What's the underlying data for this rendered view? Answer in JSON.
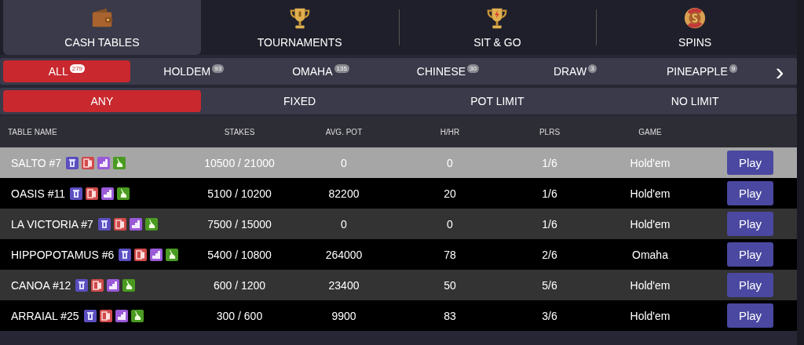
{
  "tabs": [
    {
      "label": "CASH TABLES",
      "kind": "wallet",
      "selected": true
    },
    {
      "label": "TOURNAMENTS",
      "kind": "trophy",
      "selected": false
    },
    {
      "label": "SIT & GO",
      "kind": "bolt-trophy",
      "selected": false
    },
    {
      "label": "SPINS",
      "kind": "chip",
      "selected": false
    }
  ],
  "game_filters": [
    {
      "label": "ALL",
      "count": "279",
      "selected": true
    },
    {
      "label": "HOLDEM",
      "count": "93",
      "selected": false
    },
    {
      "label": "OMAHA",
      "count": "135",
      "selected": false
    },
    {
      "label": "CHINESE",
      "count": "30",
      "selected": false
    },
    {
      "label": "DRAW",
      "count": "3",
      "selected": false
    },
    {
      "label": "PINEAPPLE",
      "count": "9",
      "selected": false
    }
  ],
  "next_button": "›",
  "limit_filters": [
    {
      "label": "ANY",
      "selected": true
    },
    {
      "label": "FIXED",
      "selected": false
    },
    {
      "label": "POT LIMIT",
      "selected": false
    },
    {
      "label": "NO LIMIT",
      "selected": false
    }
  ],
  "table": {
    "columns": [
      "TABLE NAME",
      "STAKES",
      "AVG. POT",
      "H/HR",
      "PLRS",
      "GAME"
    ],
    "rows": [
      {
        "name": "SALTO #7",
        "stakes": "10500 / 21000",
        "avg_pot": "0",
        "h_hr": "0",
        "plrs": "1/6",
        "game": "Hold'em",
        "action": "Play",
        "selected": true
      },
      {
        "name": "OASIS #11",
        "stakes": "5100 / 10200",
        "avg_pot": "82200",
        "h_hr": "20",
        "plrs": "1/6",
        "game": "Hold'em",
        "action": "Play",
        "selected": false
      },
      {
        "name": "LA VICTORIA #7",
        "stakes": "7500 / 15000",
        "avg_pot": "0",
        "h_hr": "0",
        "plrs": "1/6",
        "game": "Hold'em",
        "action": "Play",
        "selected": false
      },
      {
        "name": "HIPPOPOTAMUS #6",
        "stakes": "5400 / 10800",
        "avg_pot": "264000",
        "h_hr": "78",
        "plrs": "2/6",
        "game": "Omaha",
        "action": "Play",
        "selected": false
      },
      {
        "name": "CANOA #12",
        "stakes": "600 / 1200",
        "avg_pot": "23400",
        "h_hr": "50",
        "plrs": "5/6",
        "game": "Hold'em",
        "action": "Play",
        "selected": false
      },
      {
        "name": "ARRAIAL #25",
        "stakes": "300 / 600",
        "avg_pot": "9900",
        "h_hr": "83",
        "plrs": "3/6",
        "game": "Hold'em",
        "action": "Play",
        "selected": false
      }
    ]
  }
}
